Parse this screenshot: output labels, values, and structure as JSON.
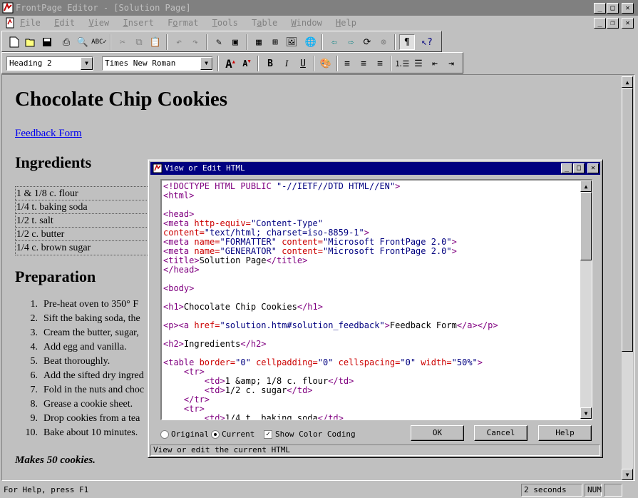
{
  "window": {
    "title": "FrontPage Editor - [Solution Page]"
  },
  "menu": {
    "items": [
      {
        "label": "File",
        "hot": "F",
        "rest": "ile"
      },
      {
        "label": "Edit",
        "hot": "E",
        "rest": "dit"
      },
      {
        "label": "View",
        "hot": "V",
        "rest": "iew"
      },
      {
        "label": "Insert",
        "hot": "I",
        "rest": "nsert"
      },
      {
        "label": "Format",
        "hot": "o",
        "pre": "F",
        "rest": "rmat"
      },
      {
        "label": "Tools",
        "hot": "T",
        "rest": "ools"
      },
      {
        "label": "Table",
        "hot": "a",
        "pre": "T",
        "rest": "ble"
      },
      {
        "label": "Window",
        "hot": "W",
        "rest": "indow"
      },
      {
        "label": "Help",
        "hot": "H",
        "rest": "elp"
      }
    ]
  },
  "format_toolbar": {
    "style_value": "Heading 2",
    "font_value": "Times New Roman"
  },
  "page": {
    "heading": "Chocolate Chip Cookies",
    "feedback_link": "Feedback Form",
    "ingredients_heading": "Ingredients",
    "ingredients": [
      "1 & 1/8 c. flour",
      "1/4 t. baking soda",
      "1/2 t. salt",
      "1/2 c. butter",
      "1/4 c. brown sugar"
    ],
    "preparation_heading": "Preparation",
    "steps": [
      {
        "num": "1.",
        "text": "Pre-heat oven to 350° F"
      },
      {
        "num": "2.",
        "text": "Sift the baking soda, the"
      },
      {
        "num": "3.",
        "text": "Cream the butter, sugar,"
      },
      {
        "num": "4.",
        "text": "Add egg and vanilla."
      },
      {
        "num": "5.",
        "text": "Beat thoroughly."
      },
      {
        "num": "6.",
        "text": "Add the sifted dry ingred"
      },
      {
        "num": "7.",
        "text": "Fold in the nuts and choc"
      },
      {
        "num": "8.",
        "text": "Grease a cookie sheet."
      },
      {
        "num": "9.",
        "text": "Drop cookies from a tea"
      },
      {
        "num": "10.",
        "text": "Bake about 10 minutes."
      }
    ],
    "makes": "Makes 50 cookies."
  },
  "dialog": {
    "title": "View or Edit HTML",
    "code_lines": [
      [
        [
          "t",
          "<!DOCTYPE HTML PUBLIC "
        ],
        [
          "v",
          "\"-//IETF//DTD HTML//EN\""
        ],
        [
          "t",
          ">"
        ]
      ],
      [
        [
          "t",
          "<html>"
        ]
      ],
      [],
      [
        [
          "t",
          "<head>"
        ]
      ],
      [
        [
          "t",
          "<meta "
        ],
        [
          "a",
          "http-equiv="
        ],
        [
          "v",
          "\"Content-Type\""
        ]
      ],
      [
        [
          "a",
          "content="
        ],
        [
          "v",
          "\"text/html; charset=iso-8859-1\""
        ],
        [
          "t",
          ">"
        ]
      ],
      [
        [
          "t",
          "<meta "
        ],
        [
          "a",
          "name="
        ],
        [
          "v",
          "\"FORMATTER\""
        ],
        [
          "a",
          " content="
        ],
        [
          "v",
          "\"Microsoft FrontPage 2.0\""
        ],
        [
          "t",
          ">"
        ]
      ],
      [
        [
          "t",
          "<meta "
        ],
        [
          "a",
          "name="
        ],
        [
          "v",
          "\"GENERATOR\""
        ],
        [
          "a",
          " content="
        ],
        [
          "v",
          "\"Microsoft FrontPage 2.0\""
        ],
        [
          "t",
          ">"
        ]
      ],
      [
        [
          "t",
          "<title>"
        ],
        [
          "x",
          "Solution Page"
        ],
        [
          "t",
          "</title>"
        ]
      ],
      [
        [
          "t",
          "</head>"
        ]
      ],
      [],
      [
        [
          "t",
          "<body>"
        ]
      ],
      [],
      [
        [
          "t",
          "<h1>"
        ],
        [
          "x",
          "Chocolate Chip Cookies"
        ],
        [
          "t",
          "</h1>"
        ]
      ],
      [],
      [
        [
          "t",
          "<p><a "
        ],
        [
          "a",
          "href="
        ],
        [
          "v",
          "\"solution.htm#solution_feedback\""
        ],
        [
          "t",
          ">"
        ],
        [
          "x",
          "Feedback Form"
        ],
        [
          "t",
          "</a></p>"
        ]
      ],
      [],
      [
        [
          "t",
          "<h2>"
        ],
        [
          "x",
          "Ingredients"
        ],
        [
          "t",
          "</h2>"
        ]
      ],
      [],
      [
        [
          "t",
          "<table "
        ],
        [
          "a",
          "border="
        ],
        [
          "v",
          "\"0\""
        ],
        [
          "a",
          " cellpadding="
        ],
        [
          "v",
          "\"0\""
        ],
        [
          "a",
          " cellspacing="
        ],
        [
          "v",
          "\"0\""
        ],
        [
          "a",
          " width="
        ],
        [
          "v",
          "\"50%\""
        ],
        [
          "t",
          ">"
        ]
      ],
      [
        [
          "x",
          "    "
        ],
        [
          "t",
          "<tr>"
        ]
      ],
      [
        [
          "x",
          "        "
        ],
        [
          "t",
          "<td>"
        ],
        [
          "x",
          "1 &amp; 1/8 c. flour"
        ],
        [
          "t",
          "</td>"
        ]
      ],
      [
        [
          "x",
          "        "
        ],
        [
          "t",
          "<td>"
        ],
        [
          "x",
          "1/2 c. sugar"
        ],
        [
          "t",
          "</td>"
        ]
      ],
      [
        [
          "x",
          "    "
        ],
        [
          "t",
          "</tr>"
        ]
      ],
      [
        [
          "x",
          "    "
        ],
        [
          "t",
          "<tr>"
        ]
      ],
      [
        [
          "x",
          "        "
        ],
        [
          "t",
          "<td>"
        ],
        [
          "x",
          "1/4 t. baking soda"
        ],
        [
          "t",
          "</td>"
        ]
      ]
    ],
    "opt_original": "Original",
    "opt_current": "Current",
    "opt_color": "Show Color Coding",
    "ok": "OK",
    "cancel": "Cancel",
    "help": "Help",
    "status": "View or edit the current HTML"
  },
  "status": {
    "text": "For Help, press F1",
    "time": "2 seconds",
    "num": "NUM"
  }
}
